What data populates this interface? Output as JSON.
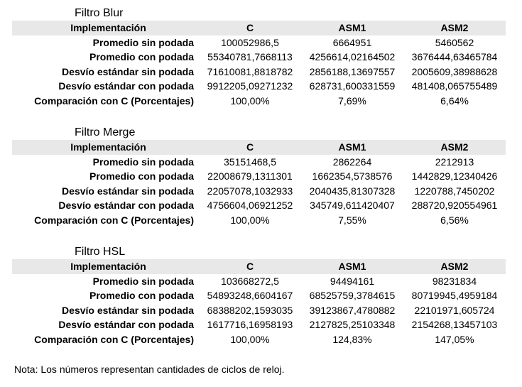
{
  "columns": [
    "Implementación",
    "C",
    "ASM1",
    "ASM2"
  ],
  "row_labels": [
    "Promedio sin podada",
    "Promedio con podada",
    "Desvío estándar sin podada",
    "Desvío estándar con podada",
    "Comparación con C (Porcentajes)"
  ],
  "tables": [
    {
      "title": "Filtro Blur",
      "rows": [
        [
          "100052986,5",
          "6664951",
          "5460562"
        ],
        [
          "55340781,7668113",
          "4256614,02164502",
          "3676444,63465784"
        ],
        [
          "71610081,8818782",
          "2856188,13697557",
          "2005609,38988628"
        ],
        [
          "9912205,09271232",
          "628731,600331559",
          "481408,065755489"
        ],
        [
          "100,00%",
          "7,69%",
          "6,64%"
        ]
      ]
    },
    {
      "title": "Filtro Merge",
      "rows": [
        [
          "35151468,5",
          "2862264",
          "2212913"
        ],
        [
          "22008679,1311301",
          "1662354,5738576",
          "1442829,12340426"
        ],
        [
          "22057078,1032933",
          "2040435,81307328",
          "1220788,7450202"
        ],
        [
          "4756604,06921252",
          "345749,611420407",
          "288720,920554961"
        ],
        [
          "100,00%",
          "7,55%",
          "6,56%"
        ]
      ]
    },
    {
      "title": "Filtro HSL",
      "rows": [
        [
          "103668272,5",
          "94494161",
          "98231834"
        ],
        [
          "54893248,6604167",
          "68525759,3784615",
          "80719945,4959184"
        ],
        [
          "68388202,1593035",
          "39123867,4780882",
          "22101971,605724"
        ],
        [
          "1617716,16958193",
          "2127825,25103348",
          "2154268,13457103"
        ],
        [
          "100,00%",
          "124,83%",
          "147,05%"
        ]
      ]
    }
  ],
  "note": "Nota: Los números representan cantidades de ciclos de reloj."
}
